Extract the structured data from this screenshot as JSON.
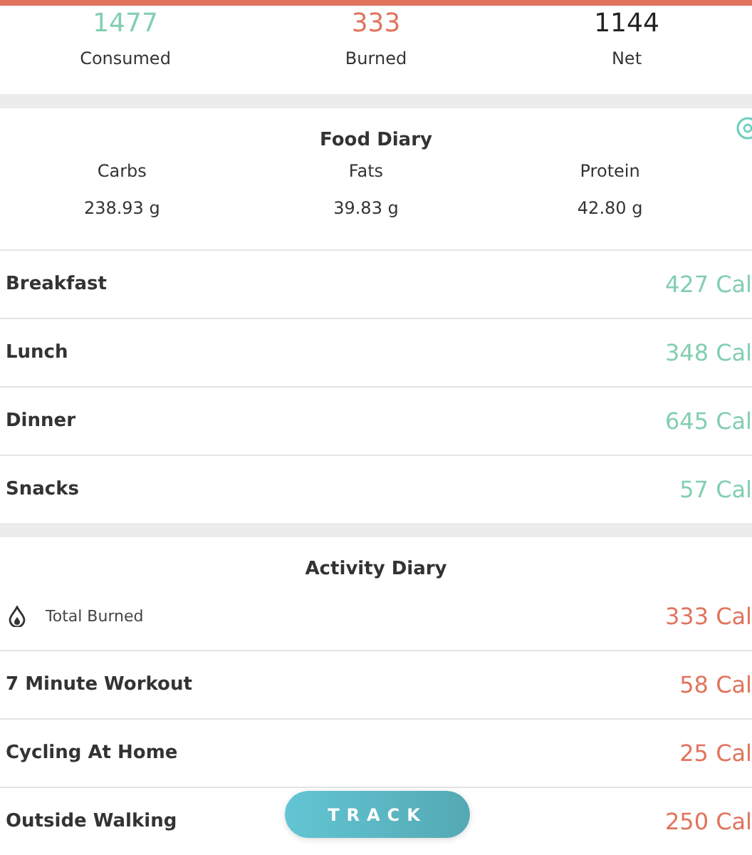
{
  "summary": [
    {
      "value": "1477",
      "label": "Consumed",
      "color": "#82cfb0"
    },
    {
      "value": "333",
      "label": "Burned",
      "color": "#e0745d"
    },
    {
      "value": "1144",
      "label": "Net",
      "color": "#222222"
    }
  ],
  "food_diary": {
    "title": "Food Diary",
    "macros": [
      {
        "label": "Carbs",
        "value": "238.93 g"
      },
      {
        "label": "Fats",
        "value": "39.83 g"
      },
      {
        "label": "Protein",
        "value": "42.80 g"
      }
    ],
    "meals": [
      {
        "name": "Breakfast",
        "calories": "427 Cal"
      },
      {
        "name": "Lunch",
        "calories": "348 Cal"
      },
      {
        "name": "Dinner",
        "calories": "645 Cal"
      },
      {
        "name": "Snacks",
        "calories": "57 Cal"
      }
    ]
  },
  "activity_diary": {
    "title": "Activity Diary",
    "total": {
      "label": "Total Burned",
      "calories": "333 Cal"
    },
    "activities": [
      {
        "name": "7 Minute Workout",
        "calories": "58 Cal"
      },
      {
        "name": "Cycling At Home",
        "calories": "25 Cal"
      },
      {
        "name": "Outside Walking",
        "calories": "250 Cal"
      }
    ]
  },
  "track_button": "TRACK"
}
